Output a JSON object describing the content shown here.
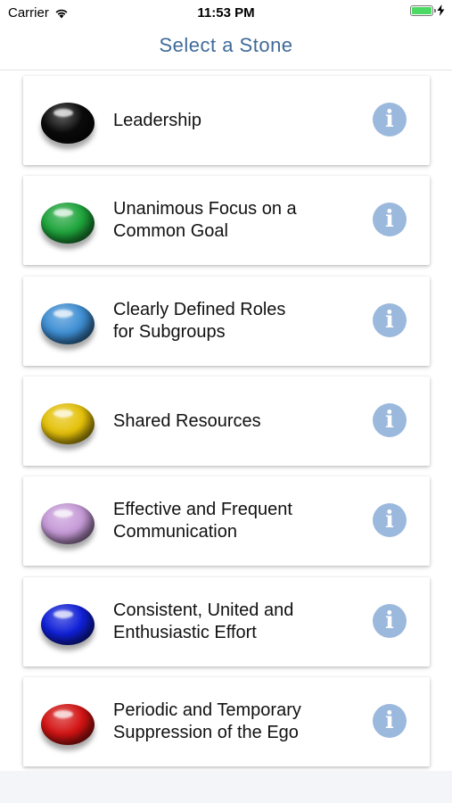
{
  "status_bar": {
    "carrier": "Carrier",
    "time": "11:53 PM"
  },
  "nav": {
    "title": "Select a Stone"
  },
  "stones": [
    {
      "label": "Leadership",
      "color": "#0b0b0b",
      "icon": "black-stone-icon"
    },
    {
      "label": "Unanimous Focus on a\nCommon Goal",
      "color": "#1fa53c",
      "icon": "green-stone-icon"
    },
    {
      "label": "Clearly Defined Roles\nfor Subgroups",
      "color": "#3f8fd4",
      "icon": "blue-stone-icon"
    },
    {
      "label": "Shared Resources",
      "color": "#e5c20a",
      "icon": "yellow-stone-icon"
    },
    {
      "label": "Effective and Frequent\nCommunication",
      "color": "#c79bd8",
      "icon": "purple-stone-icon"
    },
    {
      "label": "Consistent, United and\nEnthusiastic Effort",
      "color": "#1020d8",
      "icon": "dark-blue-stone-icon"
    },
    {
      "label": "Periodic and Temporary\nSuppression of the Ego",
      "color": "#d41414",
      "icon": "red-stone-icon"
    }
  ],
  "info_icon_glyph": "i"
}
